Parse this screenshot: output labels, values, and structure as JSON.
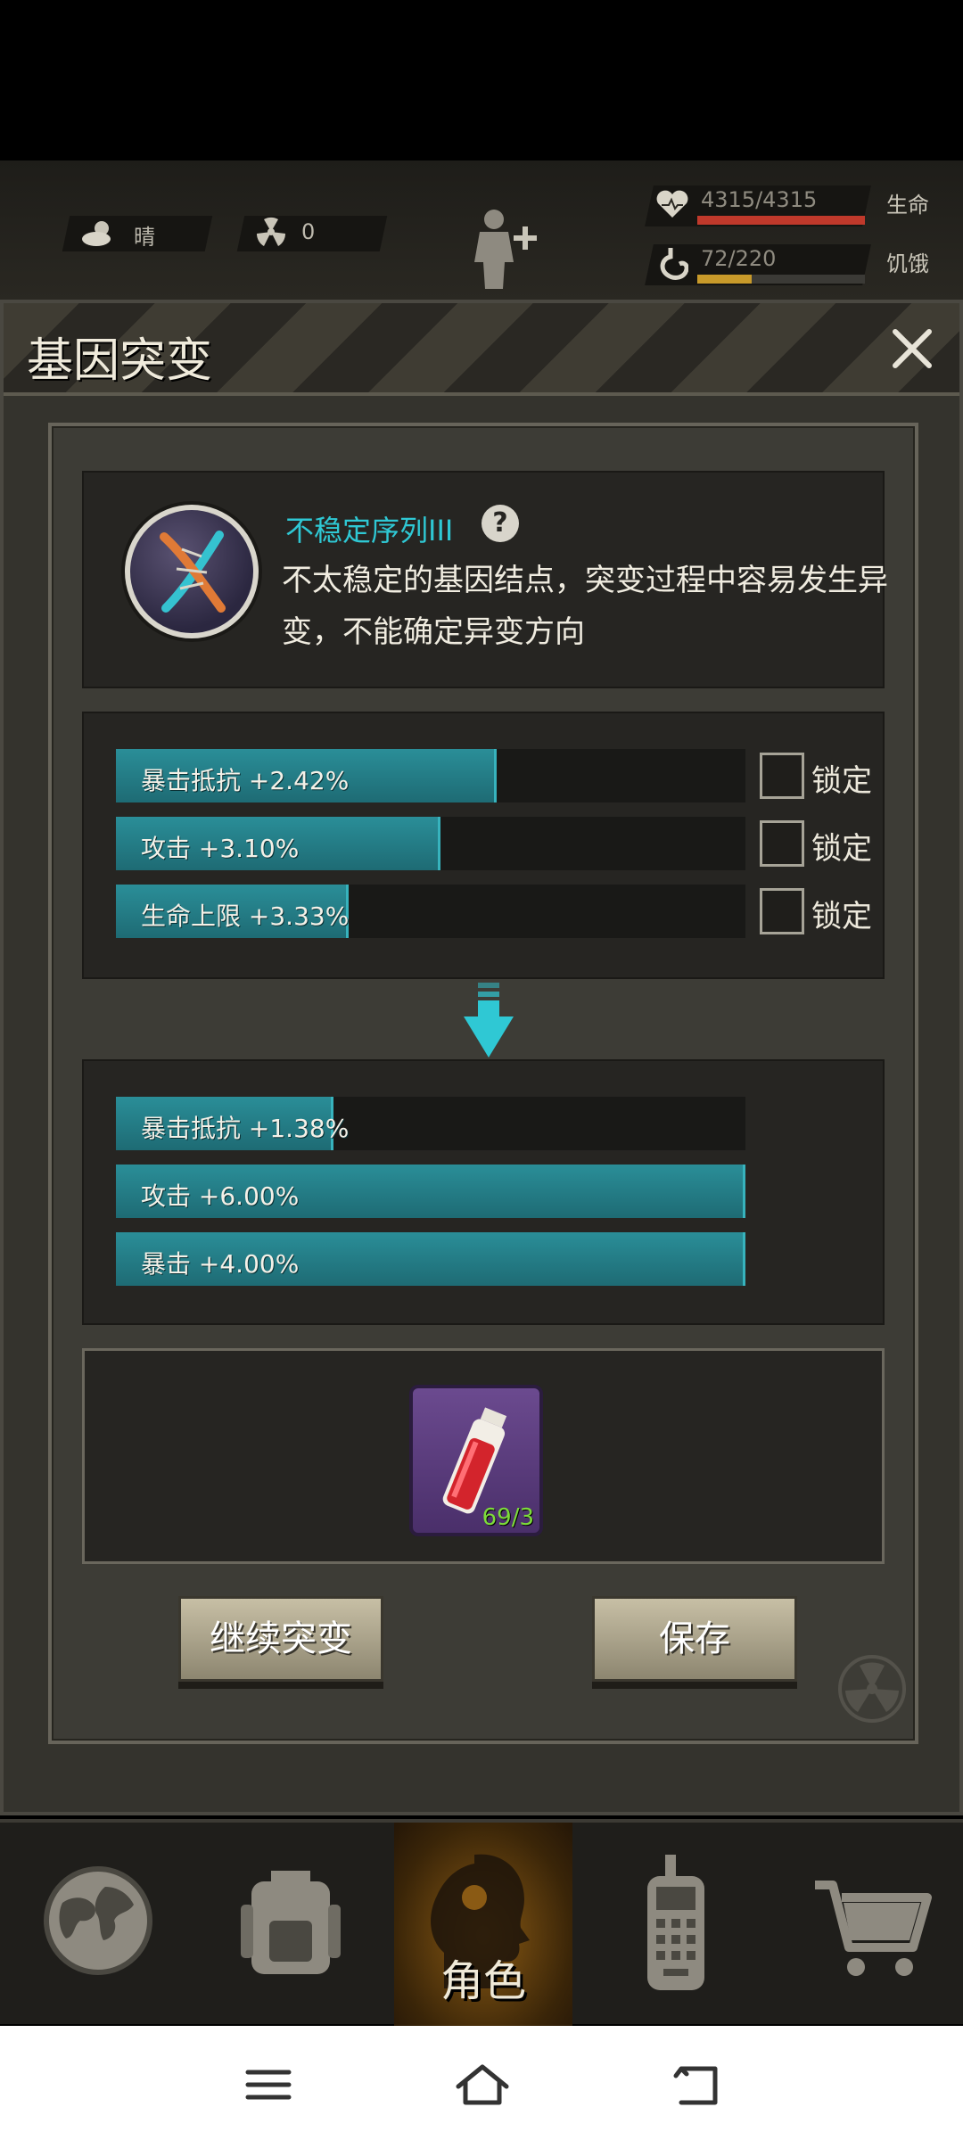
{
  "hud": {
    "weather": "晴",
    "radiation": "0",
    "health_value": "4315/4315",
    "health_label": "生命",
    "health_fraction": 1.0,
    "hunger_value": "72/220",
    "hunger_label": "饥饿",
    "hunger_fraction": 0.327
  },
  "panel": {
    "title": "基因突变"
  },
  "gene": {
    "name": "不稳定序列III",
    "description": "不太稳定的基因结点，突变过程中容易发生异变，不能确定异变方向"
  },
  "current_attributes": [
    {
      "label": "暴击抵抗 +2.42%",
      "fill": 0.605,
      "lock_label": "锁定"
    },
    {
      "label": "攻击 +3.10%",
      "fill": 0.515,
      "lock_label": "锁定"
    },
    {
      "label": "生命上限 +3.33%",
      "fill": 0.37,
      "lock_label": "锁定"
    }
  ],
  "new_attributes": [
    {
      "label": "暴击抵抗 +1.38%",
      "fill": 0.345
    },
    {
      "label": "攻击 +6.00%",
      "fill": 1.0
    },
    {
      "label": "暴击 +4.00%",
      "fill": 1.0
    }
  ],
  "item": {
    "count": "69/3"
  },
  "buttons": {
    "continue": "继续突变",
    "save": "保存"
  },
  "nav": {
    "active_label": "角色"
  },
  "colors": {
    "accent": "#2fc8d4",
    "attr_fill": "#2a8e98",
    "health": "#c0392b",
    "hunger": "#c89a2a"
  }
}
